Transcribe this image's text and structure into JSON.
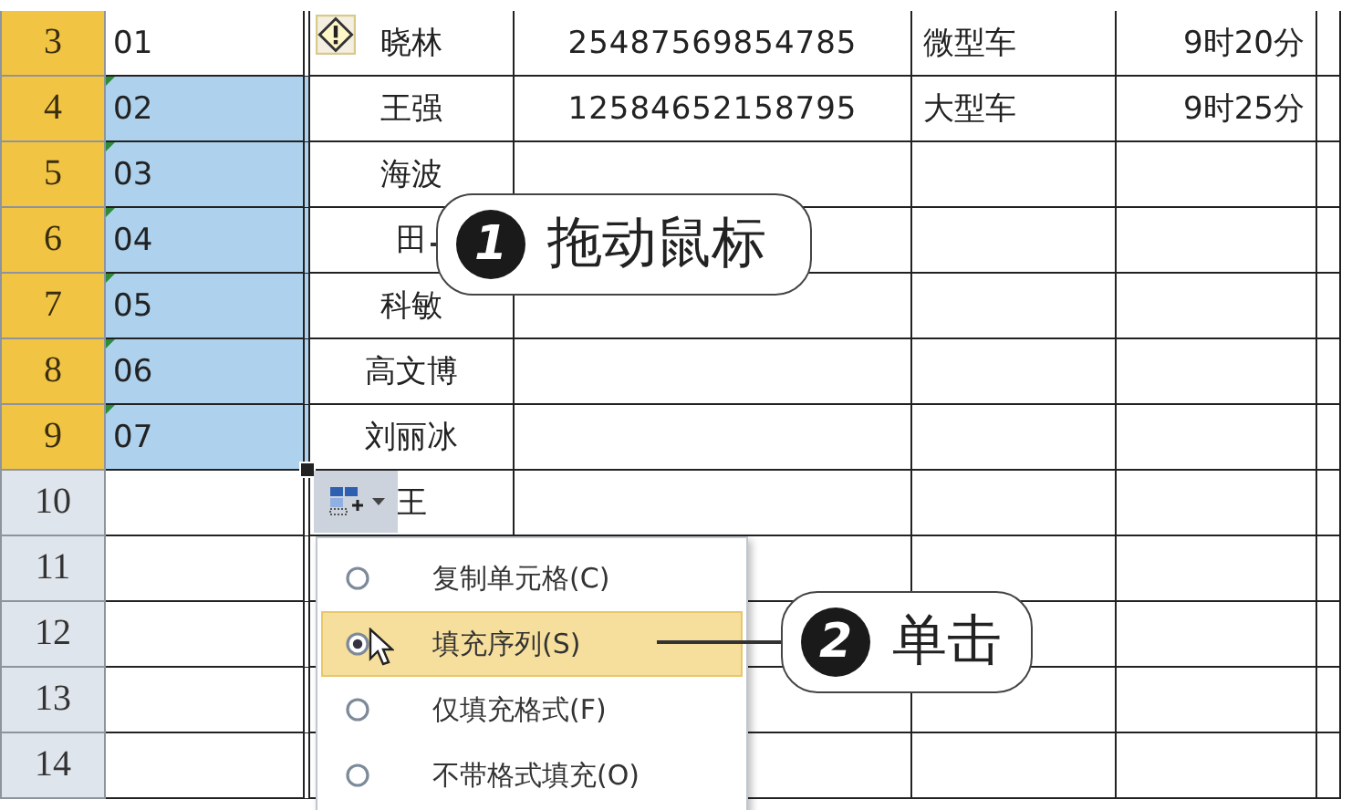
{
  "sheet": {
    "rows": [
      {
        "header": "3",
        "selected": true,
        "column_1": {
          "text": "01",
          "selected": false,
          "flag": false
        },
        "column_2": "晓林",
        "column_3": "25487569854785",
        "column_4": "微型车",
        "column_5": "9时20分"
      },
      {
        "header": "4",
        "selected": true,
        "column_1": {
          "text": "02",
          "selected": true,
          "flag": true
        },
        "column_2": "王强",
        "column_3": "12584652158795",
        "column_4": "大型车",
        "column_5": "9时25分"
      },
      {
        "header": "5",
        "selected": true,
        "column_1": {
          "text": "03",
          "selected": true,
          "flag": true
        },
        "column_2": "海波"
      },
      {
        "header": "6",
        "selected": true,
        "column_1": {
          "text": "04",
          "selected": true,
          "flag": true
        },
        "column_2": "田"
      },
      {
        "header": "7",
        "selected": true,
        "column_1": {
          "text": "05",
          "selected": true,
          "flag": true
        },
        "column_2": "科敏"
      },
      {
        "header": "8",
        "selected": true,
        "column_1": {
          "text": "06",
          "selected": true,
          "flag": true
        },
        "column_2": "高文博"
      },
      {
        "header": "9",
        "selected": true,
        "column_1": {
          "text": "07",
          "selected": true,
          "flag": true
        },
        "column_2": "刘丽冰"
      },
      {
        "header": "10",
        "selected": false,
        "column_1": {
          "selected": false,
          "flag": false
        },
        "column_2": "王"
      },
      {
        "header": "11",
        "selected": false,
        "column_1": {
          "selected": false,
          "flag": false
        }
      },
      {
        "header": "12",
        "selected": false,
        "column_1": {
          "selected": false,
          "flag": false
        }
      },
      {
        "header": "13",
        "selected": false,
        "column_1": {
          "selected": false,
          "flag": false
        }
      },
      {
        "header": "14",
        "selected": false,
        "column_1": {
          "selected": false,
          "flag": false
        }
      }
    ]
  },
  "autofill_menu": {
    "items": [
      {
        "label": "复制单元格(C)",
        "selected": false
      },
      {
        "label": "填充序列(S)",
        "selected": true
      },
      {
        "label": "仅填充格式(F)",
        "selected": false
      },
      {
        "label": "不带格式填充(O)",
        "selected": false
      }
    ]
  },
  "callouts": [
    {
      "number": "1",
      "text": "拖动鼠标"
    },
    {
      "number": "2",
      "text": "单击"
    }
  ]
}
